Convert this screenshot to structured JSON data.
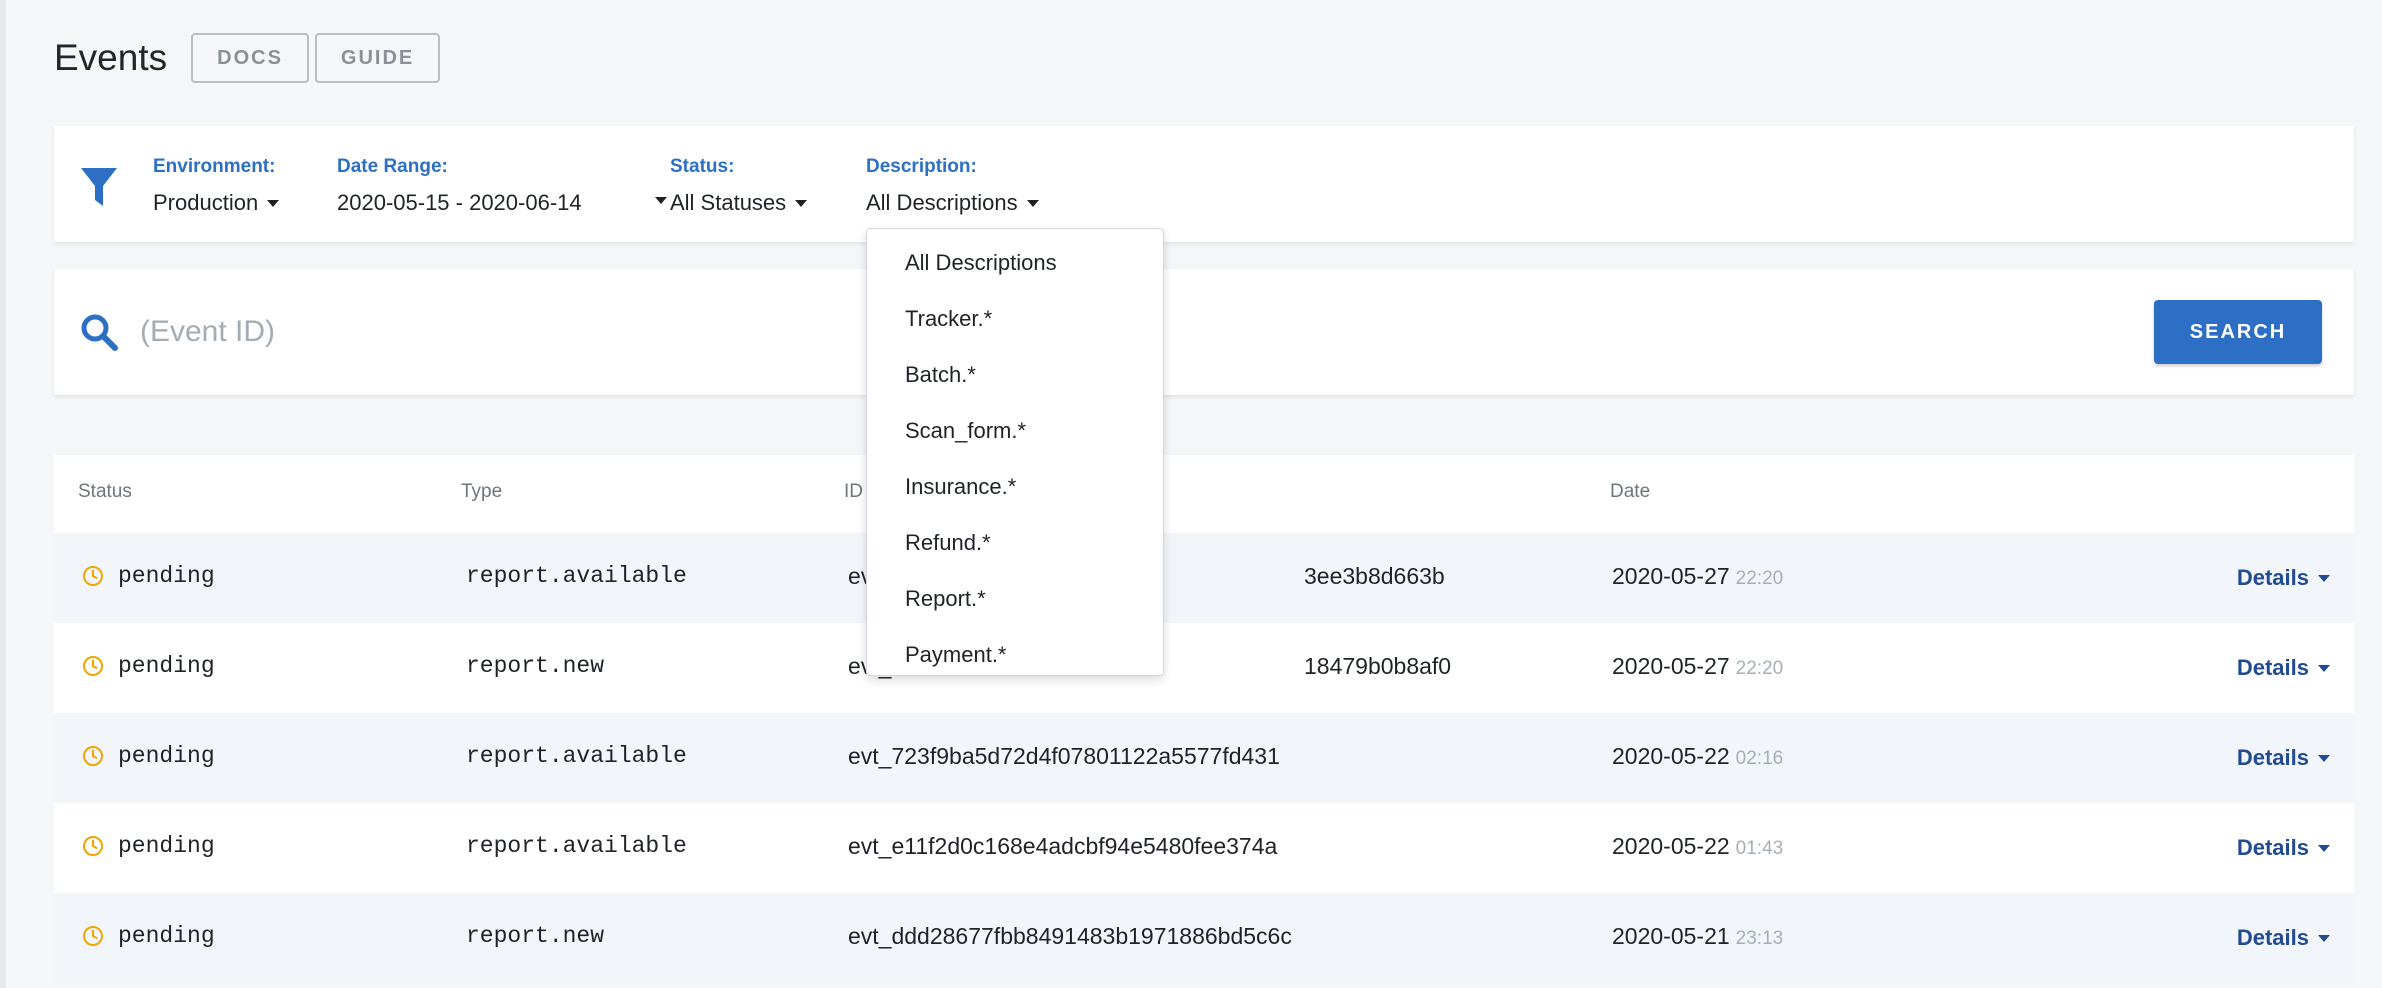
{
  "header": {
    "title": "Events",
    "docs_label": "DOCS",
    "guide_label": "GUIDE"
  },
  "filters": {
    "environment": {
      "label": "Environment:",
      "value": "Production"
    },
    "date_range": {
      "label": "Date Range:",
      "value": "2020-05-15 - 2020-06-14"
    },
    "status": {
      "label": "Status:",
      "value": "All Statuses"
    },
    "description": {
      "label": "Description:",
      "value": "All Descriptions",
      "options": [
        "All Descriptions",
        "Tracker.*",
        "Batch.*",
        "Scan_form.*",
        "Insurance.*",
        "Refund.*",
        "Report.*",
        "Payment.*"
      ]
    }
  },
  "search": {
    "placeholder": "(Event ID)",
    "button_label": "SEARCH"
  },
  "table": {
    "columns": {
      "status": "Status",
      "type": "Type",
      "id": "ID",
      "date": "Date"
    },
    "rows": [
      {
        "status": "pending",
        "type": "report.available",
        "id": "evt_",
        "date": "2020-05-27",
        "time": "22:20",
        "action": "Details"
      },
      {
        "status": "pending",
        "type": "report.new",
        "id": "evt_",
        "date": "2020-05-27",
        "time": "22:20",
        "action": "Details"
      },
      {
        "status": "pending",
        "type": "report.available",
        "id": "evt_723f9ba5d72d4f07801122a5577fd431",
        "date": "2020-05-22",
        "time": "02:16",
        "action": "Details"
      },
      {
        "status": "pending",
        "type": "report.available",
        "id": "evt_e11f2d0c168e4adcbf94e5480fee374a",
        "date": "2020-05-22",
        "time": "01:43",
        "action": "Details"
      },
      {
        "status": "pending",
        "type": "report.new",
        "id": "evt_ddd28677fbb8491483b1971886bd5c6c",
        "date": "2020-05-21",
        "time": "23:13",
        "action": "Details"
      }
    ],
    "partial_id_suffixes": [
      "3ee3b8d663b",
      "18479b0b8af0"
    ]
  },
  "colors": {
    "accent": "#2c6fc4",
    "pending": "#f0a500",
    "link": "#234b92"
  },
  "icons": {
    "filter": "filter-icon",
    "search": "search-icon",
    "status": "clock-icon",
    "caret": "caret-down-icon"
  }
}
